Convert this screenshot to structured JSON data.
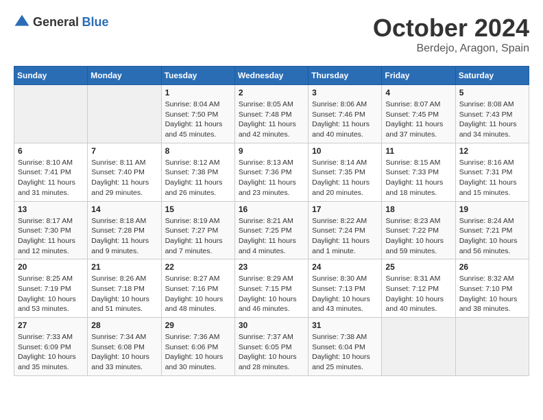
{
  "header": {
    "logo": {
      "general": "General",
      "blue": "Blue"
    },
    "title": "October 2024",
    "location": "Berdejo, Aragon, Spain"
  },
  "weekdays": [
    "Sunday",
    "Monday",
    "Tuesday",
    "Wednesday",
    "Thursday",
    "Friday",
    "Saturday"
  ],
  "weeks": [
    [
      {
        "day": null
      },
      {
        "day": null
      },
      {
        "day": "1",
        "sunrise": "Sunrise: 8:04 AM",
        "sunset": "Sunset: 7:50 PM",
        "daylight": "Daylight: 11 hours and 45 minutes."
      },
      {
        "day": "2",
        "sunrise": "Sunrise: 8:05 AM",
        "sunset": "Sunset: 7:48 PM",
        "daylight": "Daylight: 11 hours and 42 minutes."
      },
      {
        "day": "3",
        "sunrise": "Sunrise: 8:06 AM",
        "sunset": "Sunset: 7:46 PM",
        "daylight": "Daylight: 11 hours and 40 minutes."
      },
      {
        "day": "4",
        "sunrise": "Sunrise: 8:07 AM",
        "sunset": "Sunset: 7:45 PM",
        "daylight": "Daylight: 11 hours and 37 minutes."
      },
      {
        "day": "5",
        "sunrise": "Sunrise: 8:08 AM",
        "sunset": "Sunset: 7:43 PM",
        "daylight": "Daylight: 11 hours and 34 minutes."
      }
    ],
    [
      {
        "day": "6",
        "sunrise": "Sunrise: 8:10 AM",
        "sunset": "Sunset: 7:41 PM",
        "daylight": "Daylight: 11 hours and 31 minutes."
      },
      {
        "day": "7",
        "sunrise": "Sunrise: 8:11 AM",
        "sunset": "Sunset: 7:40 PM",
        "daylight": "Daylight: 11 hours and 29 minutes."
      },
      {
        "day": "8",
        "sunrise": "Sunrise: 8:12 AM",
        "sunset": "Sunset: 7:38 PM",
        "daylight": "Daylight: 11 hours and 26 minutes."
      },
      {
        "day": "9",
        "sunrise": "Sunrise: 8:13 AM",
        "sunset": "Sunset: 7:36 PM",
        "daylight": "Daylight: 11 hours and 23 minutes."
      },
      {
        "day": "10",
        "sunrise": "Sunrise: 8:14 AM",
        "sunset": "Sunset: 7:35 PM",
        "daylight": "Daylight: 11 hours and 20 minutes."
      },
      {
        "day": "11",
        "sunrise": "Sunrise: 8:15 AM",
        "sunset": "Sunset: 7:33 PM",
        "daylight": "Daylight: 11 hours and 18 minutes."
      },
      {
        "day": "12",
        "sunrise": "Sunrise: 8:16 AM",
        "sunset": "Sunset: 7:31 PM",
        "daylight": "Daylight: 11 hours and 15 minutes."
      }
    ],
    [
      {
        "day": "13",
        "sunrise": "Sunrise: 8:17 AM",
        "sunset": "Sunset: 7:30 PM",
        "daylight": "Daylight: 11 hours and 12 minutes."
      },
      {
        "day": "14",
        "sunrise": "Sunrise: 8:18 AM",
        "sunset": "Sunset: 7:28 PM",
        "daylight": "Daylight: 11 hours and 9 minutes."
      },
      {
        "day": "15",
        "sunrise": "Sunrise: 8:19 AM",
        "sunset": "Sunset: 7:27 PM",
        "daylight": "Daylight: 11 hours and 7 minutes."
      },
      {
        "day": "16",
        "sunrise": "Sunrise: 8:21 AM",
        "sunset": "Sunset: 7:25 PM",
        "daylight": "Daylight: 11 hours and 4 minutes."
      },
      {
        "day": "17",
        "sunrise": "Sunrise: 8:22 AM",
        "sunset": "Sunset: 7:24 PM",
        "daylight": "Daylight: 11 hours and 1 minute."
      },
      {
        "day": "18",
        "sunrise": "Sunrise: 8:23 AM",
        "sunset": "Sunset: 7:22 PM",
        "daylight": "Daylight: 10 hours and 59 minutes."
      },
      {
        "day": "19",
        "sunrise": "Sunrise: 8:24 AM",
        "sunset": "Sunset: 7:21 PM",
        "daylight": "Daylight: 10 hours and 56 minutes."
      }
    ],
    [
      {
        "day": "20",
        "sunrise": "Sunrise: 8:25 AM",
        "sunset": "Sunset: 7:19 PM",
        "daylight": "Daylight: 10 hours and 53 minutes."
      },
      {
        "day": "21",
        "sunrise": "Sunrise: 8:26 AM",
        "sunset": "Sunset: 7:18 PM",
        "daylight": "Daylight: 10 hours and 51 minutes."
      },
      {
        "day": "22",
        "sunrise": "Sunrise: 8:27 AM",
        "sunset": "Sunset: 7:16 PM",
        "daylight": "Daylight: 10 hours and 48 minutes."
      },
      {
        "day": "23",
        "sunrise": "Sunrise: 8:29 AM",
        "sunset": "Sunset: 7:15 PM",
        "daylight": "Daylight: 10 hours and 46 minutes."
      },
      {
        "day": "24",
        "sunrise": "Sunrise: 8:30 AM",
        "sunset": "Sunset: 7:13 PM",
        "daylight": "Daylight: 10 hours and 43 minutes."
      },
      {
        "day": "25",
        "sunrise": "Sunrise: 8:31 AM",
        "sunset": "Sunset: 7:12 PM",
        "daylight": "Daylight: 10 hours and 40 minutes."
      },
      {
        "day": "26",
        "sunrise": "Sunrise: 8:32 AM",
        "sunset": "Sunset: 7:10 PM",
        "daylight": "Daylight: 10 hours and 38 minutes."
      }
    ],
    [
      {
        "day": "27",
        "sunrise": "Sunrise: 7:33 AM",
        "sunset": "Sunset: 6:09 PM",
        "daylight": "Daylight: 10 hours and 35 minutes."
      },
      {
        "day": "28",
        "sunrise": "Sunrise: 7:34 AM",
        "sunset": "Sunset: 6:08 PM",
        "daylight": "Daylight: 10 hours and 33 minutes."
      },
      {
        "day": "29",
        "sunrise": "Sunrise: 7:36 AM",
        "sunset": "Sunset: 6:06 PM",
        "daylight": "Daylight: 10 hours and 30 minutes."
      },
      {
        "day": "30",
        "sunrise": "Sunrise: 7:37 AM",
        "sunset": "Sunset: 6:05 PM",
        "daylight": "Daylight: 10 hours and 28 minutes."
      },
      {
        "day": "31",
        "sunrise": "Sunrise: 7:38 AM",
        "sunset": "Sunset: 6:04 PM",
        "daylight": "Daylight: 10 hours and 25 minutes."
      },
      {
        "day": null
      },
      {
        "day": null
      }
    ]
  ]
}
